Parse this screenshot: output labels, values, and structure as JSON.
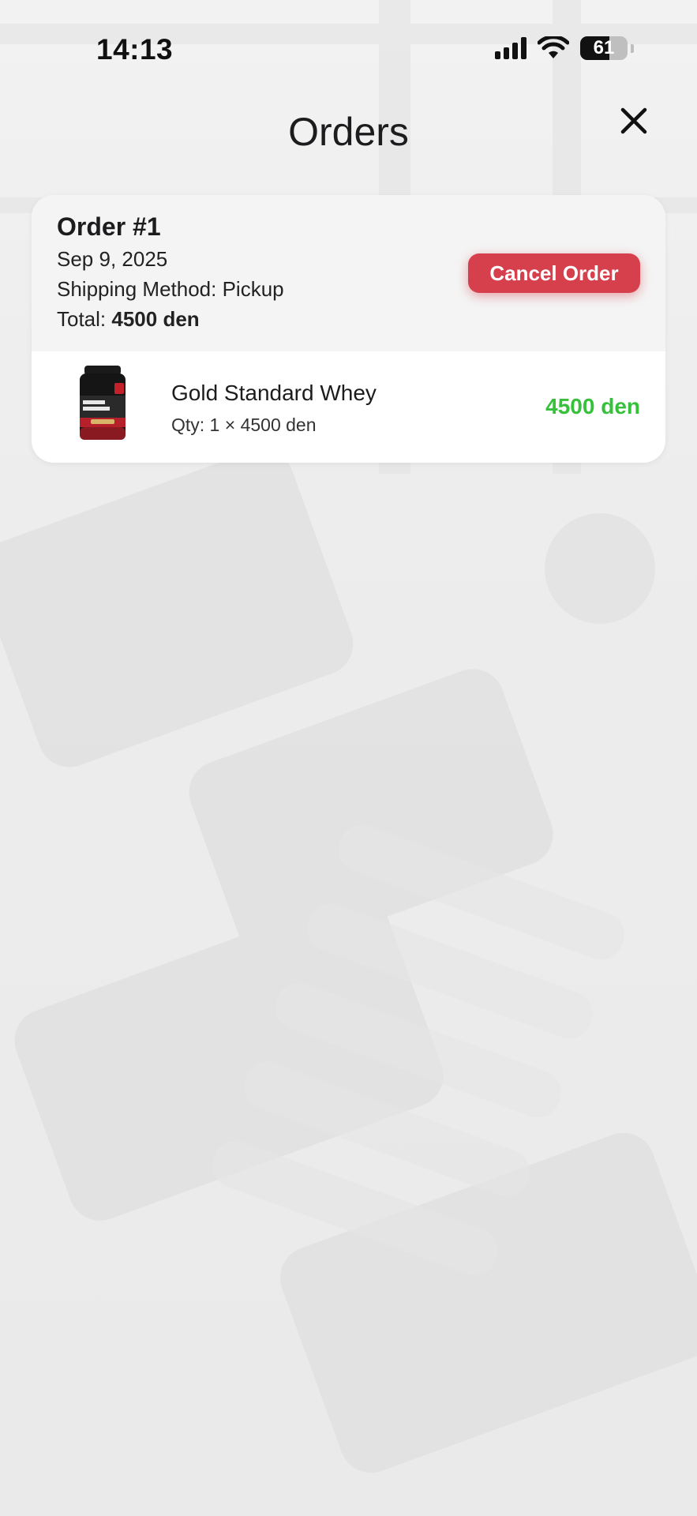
{
  "status_bar": {
    "time": "14:13",
    "battery_level": "61",
    "icons": [
      "cellular-signal-icon",
      "wifi-icon",
      "battery-icon"
    ]
  },
  "header": {
    "title": "Orders",
    "close_icon": "close-icon"
  },
  "orders": [
    {
      "title": "Order #1",
      "date": "Sep 9, 2025",
      "shipping": "Shipping Method: Pickup",
      "total_label": "Total: ",
      "total_value": "4500 den",
      "cancel_label": "Cancel Order",
      "items": [
        {
          "name": "Gold Standard Whey",
          "qty": "Qty: 1 × 4500 den",
          "price": "4500 den",
          "image": "protein-tub-image"
        }
      ]
    }
  ],
  "colors": {
    "cancel_button": "#d6404c",
    "price_green": "#35c23a",
    "card_header_bg": "#f4f4f4"
  }
}
